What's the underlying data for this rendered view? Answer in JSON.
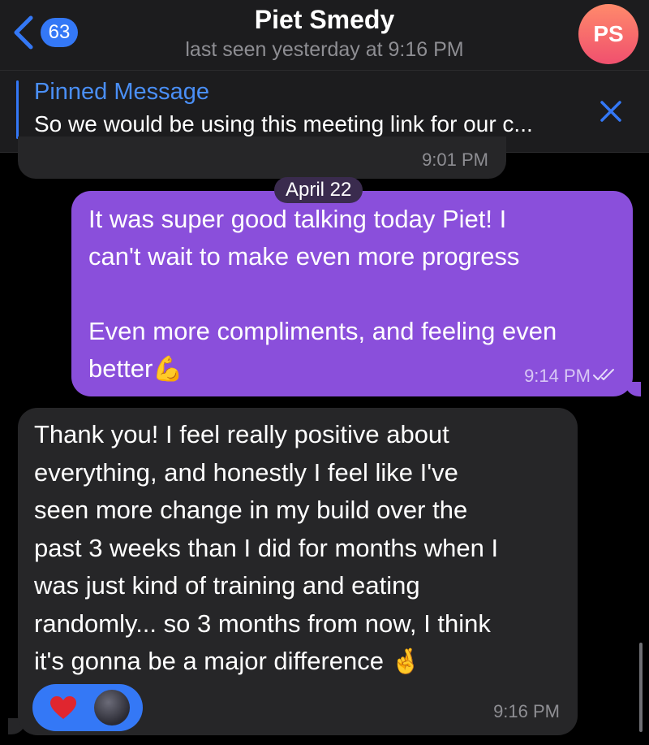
{
  "header": {
    "unread_count": "63",
    "contact_name": "Piet Smedy",
    "status": "last seen yesterday at 9:16 PM",
    "avatar_initials": "PS",
    "accent_color": "#3478f6"
  },
  "pinned": {
    "title": "Pinned Message",
    "text": "So we would be using this meeting link for our c..."
  },
  "messages": {
    "previous_time": "9:01 PM",
    "date_separator": "April 22",
    "outgoing": {
      "text": "It was super good talking today Piet! I\ncan't wait to make even more progress\n\nEven more compliments, and feeling even\nbetter",
      "emoji": "💪",
      "time": "9:14 PM",
      "status_icon": "double-check-read",
      "bubble_color": "#8a4fdb"
    },
    "incoming": {
      "text": "Thank you! I feel really positive about\neverything, and honestly I feel like I've\nseen more change in my build over the\npast 3 weeks than I did for months when I\nwas just kind of training and eating\nrandomly... so 3 months from now, I think\nit's gonna be a major difference ",
      "emoji": "🤞",
      "time": "9:16 PM",
      "reaction": "heart"
    }
  }
}
